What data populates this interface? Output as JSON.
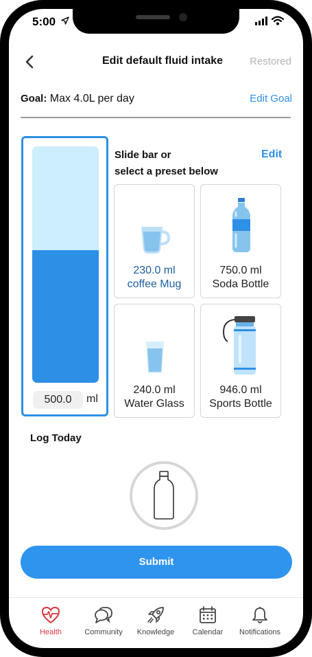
{
  "status_bar": {
    "time": "5:00"
  },
  "header": {
    "title": "Edit default fluid intake",
    "action": "Restored"
  },
  "goal": {
    "label": "Goal:",
    "value": "Max 4.0L per day",
    "edit_label": "Edit Goal"
  },
  "slider": {
    "amount": "500.0",
    "unit": "ml",
    "fill_fraction": 0.56
  },
  "presets_intro": {
    "line1": "Slide bar or",
    "line2": "select a preset below",
    "edit_label": "Edit"
  },
  "presets": [
    {
      "amount": "230.0 ml",
      "name": "coffee Mug",
      "icon": "coffee-mug-icon",
      "selected": true
    },
    {
      "amount": "750.0 ml",
      "name": "Soda Bottle",
      "icon": "soda-bottle-icon",
      "selected": false
    },
    {
      "amount": "240.0 ml",
      "name": "Water Glass",
      "icon": "water-glass-icon",
      "selected": false
    },
    {
      "amount": "946.0 ml",
      "name": "Sports Bottle",
      "icon": "sports-bottle-icon",
      "selected": false
    }
  ],
  "log_today": {
    "title": "Log Today"
  },
  "submit": {
    "label": "Submit"
  },
  "tabs": [
    {
      "label": "Health",
      "icon": "heart-pulse-icon",
      "active": true
    },
    {
      "label": "Community",
      "icon": "chat-bubbles-icon",
      "active": false
    },
    {
      "label": "Knowledge",
      "icon": "rocket-icon",
      "active": false
    },
    {
      "label": "Calendar",
      "icon": "calendar-icon",
      "active": false
    },
    {
      "label": "Notifications",
      "icon": "bell-icon",
      "active": false
    }
  ],
  "colors": {
    "accent": "#2e8fe6",
    "light_fill": "#cdeefc",
    "active_tab": "#d9363e",
    "muted": "#b5b5b5"
  }
}
